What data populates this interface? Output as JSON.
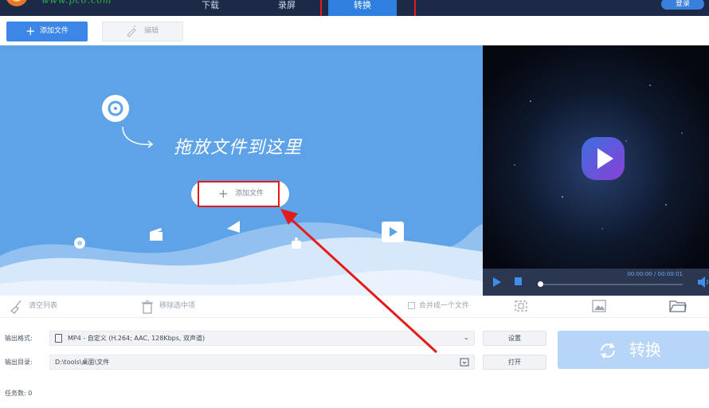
{
  "nav": {
    "tabs": [
      {
        "label": "下载"
      },
      {
        "label": "录屏"
      },
      {
        "label": "转换"
      }
    ],
    "active_tab": "转换",
    "login_label": "登录"
  },
  "toolbar": {
    "add_file_label": "添加文件",
    "edit_label": "编辑"
  },
  "dropzone": {
    "hint": "拖放文件到这里",
    "add_file_label": "添加文件"
  },
  "player": {
    "time": "00:00:00 / 00:00:01",
    "progress": 0.0
  },
  "actions": {
    "clear_list": "清空列表",
    "remove_selected": "移除选中项",
    "merge_label": "合并成一个文件",
    "merge_checked": false
  },
  "output": {
    "format_label": "输出格式:",
    "format_value": "MP4 - 自定义 (H.264; AAC, 128Kbps, 双声道)",
    "dir_label": "输出目录:",
    "dir_value": "D:\\tools\\桌面\\文件",
    "settings_button": "设置",
    "open_button": "打开",
    "convert_button": "转换",
    "task_count": "任务数: 0"
  },
  "colors": {
    "accent": "#3b86e6",
    "dropzone": "#5ea3e8",
    "annotation": "#e31b1b",
    "nav_bg": "#1c2a48"
  }
}
